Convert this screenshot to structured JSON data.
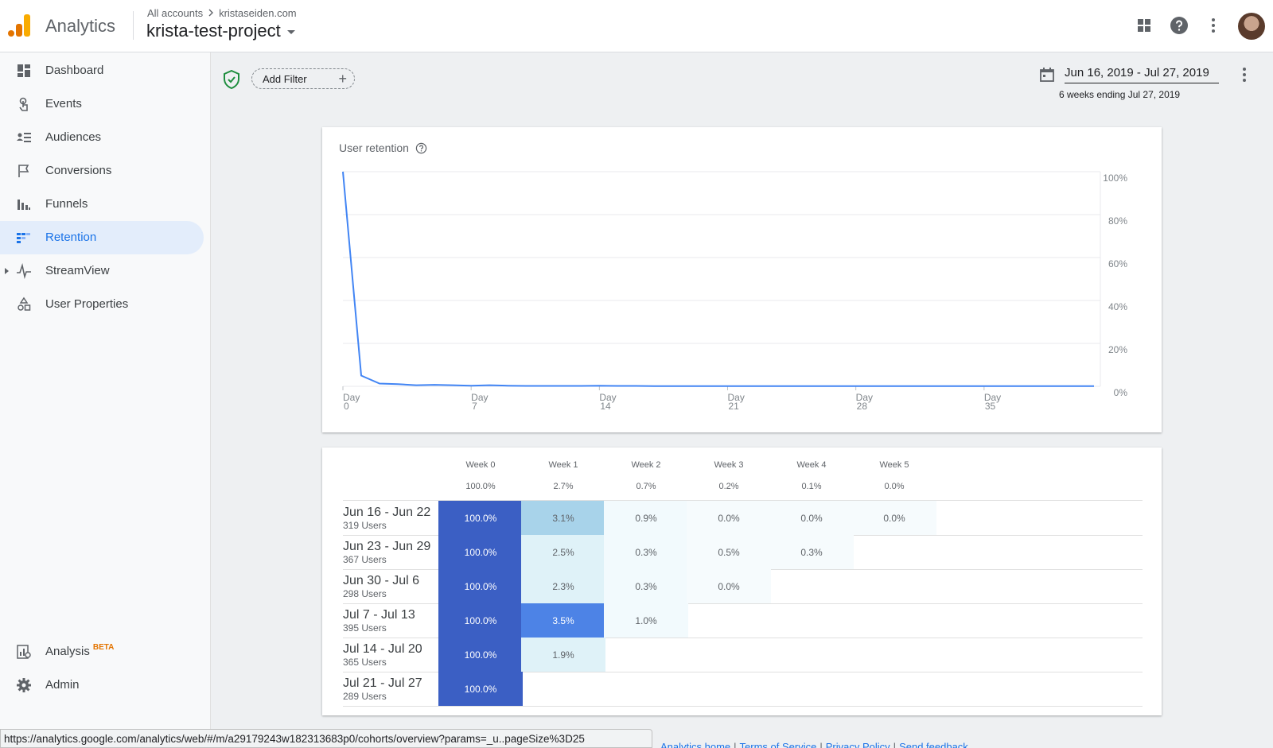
{
  "header": {
    "app_name": "Analytics",
    "breadcrumb_root": "All accounts",
    "breadcrumb_account": "kristaseiden.com",
    "project_name": "krista-test-project"
  },
  "sidebar": {
    "items": [
      {
        "label": "Dashboard",
        "icon": "dashboard-icon"
      },
      {
        "label": "Events",
        "icon": "touch-icon"
      },
      {
        "label": "Audiences",
        "icon": "audiences-icon"
      },
      {
        "label": "Conversions",
        "icon": "flag-icon"
      },
      {
        "label": "Funnels",
        "icon": "funnel-icon"
      },
      {
        "label": "Retention",
        "icon": "retention-icon",
        "active": true
      },
      {
        "label": "StreamView",
        "icon": "streamview-icon"
      },
      {
        "label": "User Properties",
        "icon": "shapes-icon"
      }
    ],
    "analysis_label": "Analysis",
    "analysis_badge": "BETA",
    "admin_label": "Admin"
  },
  "toolbar": {
    "add_filter": "Add Filter",
    "date_range": "Jun 16, 2019 - Jul 27, 2019",
    "date_subtitle": "6 weeks ending Jul 27, 2019"
  },
  "chart_data": {
    "type": "line",
    "title": "User retention",
    "x_tick_labels": [
      [
        "Day",
        "0"
      ],
      [
        "Day",
        "7"
      ],
      [
        "Day",
        "14"
      ],
      [
        "Day",
        "21"
      ],
      [
        "Day",
        "28"
      ],
      [
        "Day",
        "35"
      ]
    ],
    "x_ticks": [
      0,
      7,
      14,
      21,
      28,
      35
    ],
    "y_tick_labels": [
      "100%",
      "80%",
      "60%",
      "40%",
      "20%",
      "0%"
    ],
    "y_ticks": [
      100,
      80,
      60,
      40,
      20,
      0
    ],
    "xlim": [
      0,
      41
    ],
    "ylim": [
      0,
      100
    ],
    "series": [
      {
        "color": "#4285f4",
        "x": [
          0,
          1,
          2,
          3,
          4,
          5,
          6,
          7,
          8,
          9,
          10,
          11,
          12,
          13,
          14,
          15,
          16,
          17,
          18,
          19,
          20,
          21,
          22,
          23,
          24,
          25,
          26,
          27,
          28,
          29,
          30,
          31,
          32,
          33,
          34,
          35,
          36,
          37,
          38,
          39,
          40,
          41
        ],
        "y": [
          100,
          5.0,
          1.3,
          1.0,
          0.5,
          0.7,
          0.5,
          0.3,
          0.5,
          0.3,
          0.2,
          0.2,
          0.2,
          0.2,
          0.3,
          0.2,
          0.2,
          0.1,
          0.1,
          0.1,
          0.1,
          0.1,
          0.1,
          0.1,
          0.1,
          0.1,
          0.1,
          0.1,
          0.1,
          0.1,
          0.1,
          0.1,
          0.1,
          0.1,
          0.1,
          0.1,
          0.1,
          0.1,
          0.1,
          0.1,
          0.1,
          0.1
        ]
      }
    ]
  },
  "cohort_table": {
    "weeks": [
      "Week 0",
      "Week 1",
      "Week 2",
      "Week 3",
      "Week 4",
      "Week 5"
    ],
    "averages": [
      "100.0%",
      "2.7%",
      "0.7%",
      "0.2%",
      "0.1%",
      "0.0%"
    ],
    "rows": [
      {
        "label": "Jun 16 - Jun 22",
        "users": "319 Users",
        "cells": [
          "100.0%",
          "3.1%",
          "0.9%",
          "0.0%",
          "0.0%",
          "0.0%"
        ]
      },
      {
        "label": "Jun 23 - Jun 29",
        "users": "367 Users",
        "cells": [
          "100.0%",
          "2.5%",
          "0.3%",
          "0.5%",
          "0.3%"
        ]
      },
      {
        "label": "Jun 30 - Jul 6",
        "users": "298 Users",
        "cells": [
          "100.0%",
          "2.3%",
          "0.3%",
          "0.0%"
        ]
      },
      {
        "label": "Jul 7 - Jul 13",
        "users": "395 Users",
        "cells": [
          "100.0%",
          "3.5%",
          "1.0%"
        ]
      },
      {
        "label": "Jul 14 - Jul 20",
        "users": "365 Users",
        "cells": [
          "100.0%",
          "1.9%"
        ]
      },
      {
        "label": "Jul 21 - Jul 27",
        "users": "289 Users",
        "cells": [
          "100.0%"
        ]
      }
    ],
    "cell_colors": [
      [
        "#3b5fc4",
        "#a8d3ea",
        "#f2fafd",
        "#f6fbfd",
        "#f6fbfd",
        "#f6fbfd"
      ],
      [
        "#3b5fc4",
        "#dff2f8",
        "#f2fafd",
        "#f6fbfd",
        "#f6fbfd"
      ],
      [
        "#3b5fc4",
        "#dff2f8",
        "#f2fafd",
        "#f6fbfd"
      ],
      [
        "#3b5fc4",
        "#4d83e6",
        "#f2fafd"
      ],
      [
        "#3b5fc4",
        "#dff2f8"
      ],
      [
        "#3b5fc4"
      ]
    ]
  },
  "status_bar": {
    "url": "https://analytics.google.com/analytics/web/#/m/a29179243w182313683p0/cohorts/overview?params=_u..pageSize%3D25"
  },
  "footer": {
    "links": [
      "Analytics home",
      "Terms of Service",
      "Privacy Policy",
      "Send feedback"
    ]
  }
}
